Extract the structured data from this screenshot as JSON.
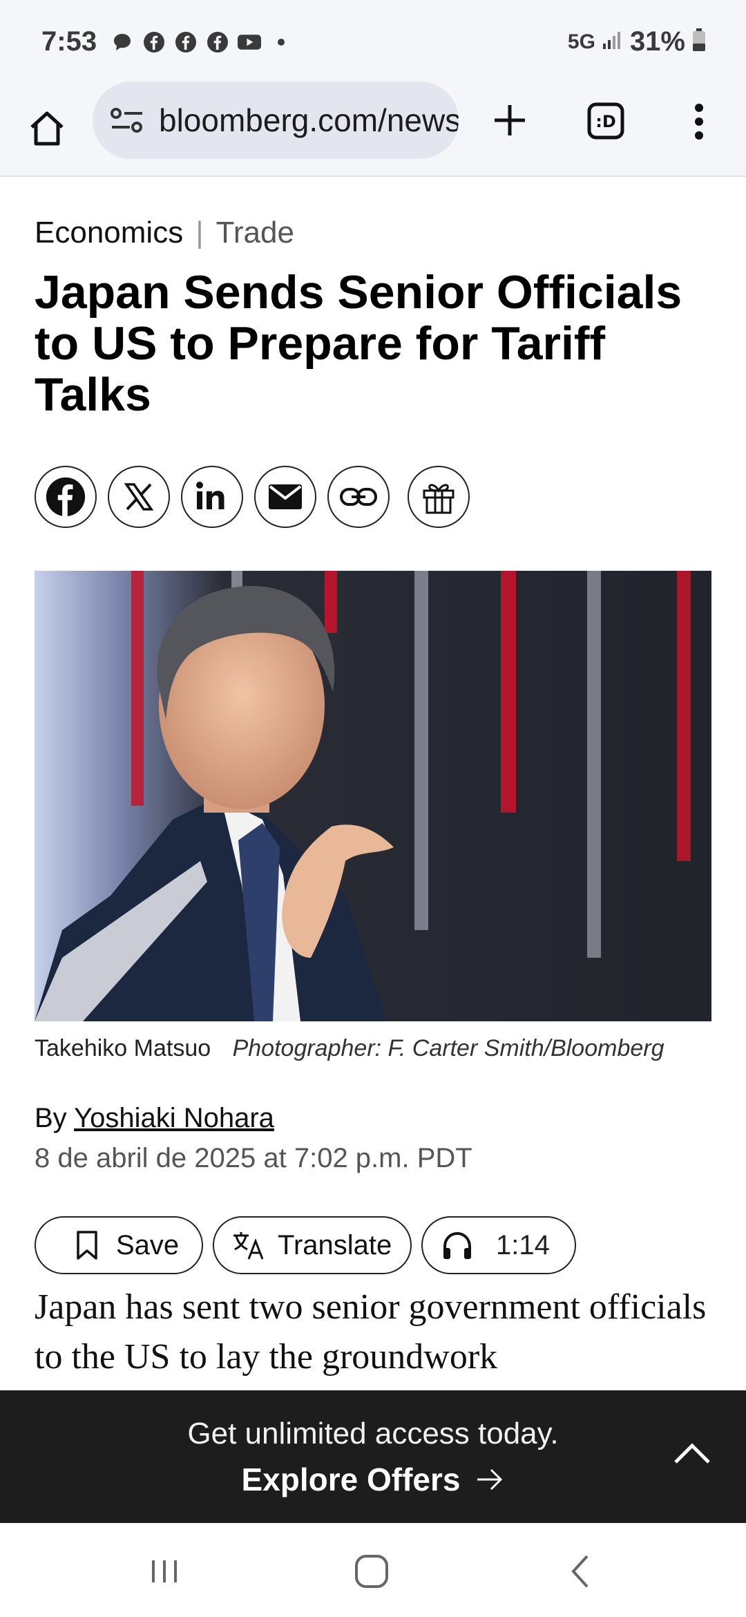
{
  "status_bar": {
    "time": "7:53",
    "notification_icons": [
      "chat-icon",
      "facebook-icon",
      "facebook-icon",
      "facebook-icon",
      "youtube-icon",
      "dot-icon"
    ],
    "network": "5G",
    "battery": "31%"
  },
  "browser": {
    "url": "bloomberg.com/news/articles/japan-sends-senior-officials"
  },
  "article": {
    "section": "Economics",
    "subsection": "Trade",
    "headline": "Japan Sends Senior Officials to US to Prepare for Tariff Talks",
    "share_buttons": [
      "facebook-icon",
      "x-icon",
      "linkedin-icon",
      "email-icon",
      "link-icon",
      "gift-icon"
    ],
    "caption_name": "Takehiko Matsuo",
    "caption_credit": "Photographer: F. Carter Smith/Bloomberg",
    "byline_prefix": "By",
    "author": "Yoshiaki Nohara",
    "date": "8 de abril de 2025 at 7:02 p.m. PDT",
    "actions": {
      "save": "Save",
      "translate": "Translate",
      "listen_duration": "1:14"
    },
    "body_start": "Japan has sent two senior government officials to the US to lay the groundwork"
  },
  "offer": {
    "title": "Get unlimited access today.",
    "cta": "Explore Offers"
  },
  "colors": {
    "banner_bg": "#1d1d1d",
    "status_bg": "#f5f6fa",
    "url_pill_bg": "#e3e6ee"
  }
}
